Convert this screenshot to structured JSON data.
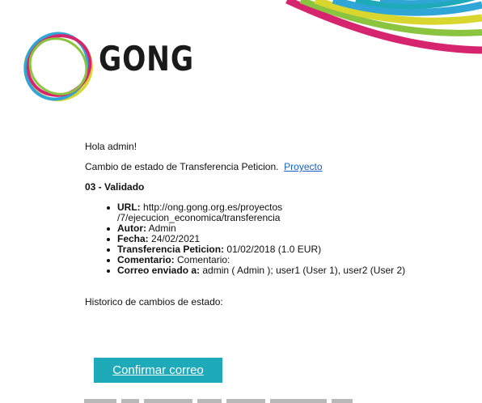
{
  "brand": {
    "name": "GONG"
  },
  "colors": {
    "accent_blue": "#2fa6d6",
    "accent_yellow": "#d9d62e",
    "accent_green": "#8bc43f",
    "accent_magenta": "#d6246e",
    "button_bg": "#1eaab8",
    "link": "#1a5fc8"
  },
  "email": {
    "greeting": "Hola admin!",
    "intro": "Cambio de estado de Transferencia Peticion.",
    "intro_link": "Proyecto",
    "state_title": "03 - Validado",
    "details": [
      {
        "label": "URL:",
        "value": "http://ong.gong.org.es/proyectos",
        "value_cont": "/7/ejecucion_economica/transferencia"
      },
      {
        "label": "Autor:",
        "value": "Admin"
      },
      {
        "label": "Fecha:",
        "value": "24/02/2021"
      },
      {
        "label": "Transferencia Peticion:",
        "value": "01/02/2018 (1.0 EUR)"
      },
      {
        "label": "Comentario:",
        "value": "Comentario:"
      },
      {
        "label": "Correo enviado a:",
        "value": "admin ( Admin ); user1 (User 1),  user2 (User 2)"
      }
    ],
    "history_label": "Historico de cambios de estado:",
    "confirm_button": "Confirmar correo"
  }
}
